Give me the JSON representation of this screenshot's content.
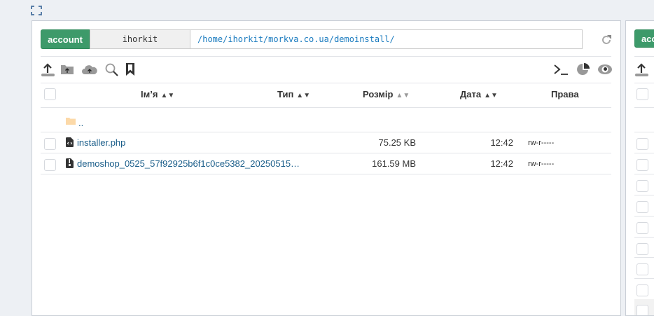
{
  "left_panel": {
    "account_label": "account",
    "user": "ihorkit",
    "path": "/home/ihorkit/morkva.co.ua/demoinstall/",
    "columns": {
      "name": "Ім’я",
      "type": "Тип",
      "size": "Розмір",
      "date": "Дата",
      "perms": "Права"
    },
    "parent_dir": "..",
    "files": [
      {
        "name": "installer.php",
        "size": "75.25 KB",
        "date": "12:42",
        "perms": "rw-r-----"
      },
      {
        "name": "demoshop_0525_57f92925b6f1c0ce5382_20250515…",
        "size": "161.59 MB",
        "date": "12:42",
        "perms": "rw-r-----"
      }
    ]
  },
  "right_panel": {
    "account_label": "account"
  },
  "colors": {
    "accent": "#3d9a6a",
    "link": "#1b5e8a",
    "path": "#1a7bbf",
    "folder": "#fcd9a8"
  }
}
